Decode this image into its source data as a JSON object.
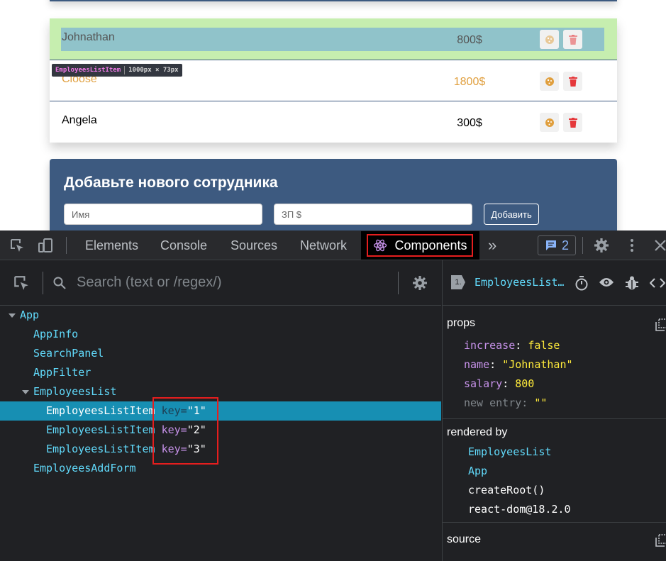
{
  "page": {
    "employees": [
      {
        "name": "Johnathan",
        "salary": "800$"
      },
      {
        "name": "Cloose",
        "salary": "1800$"
      },
      {
        "name": "Angela",
        "salary": "300$"
      }
    ],
    "tooltip": {
      "component": "EmployeesListItem",
      "dims": "1000px × 73px"
    },
    "add_form": {
      "title": "Добавьте нового сотрудника",
      "name_placeholder": "Имя",
      "salary_placeholder": "ЗП $",
      "submit_label": "Добавить"
    }
  },
  "devtools": {
    "tabs": [
      "Elements",
      "Console",
      "Sources",
      "Network"
    ],
    "active_tab": "Components",
    "more": "»",
    "issues_count": "2",
    "search_placeholder": "Search (text or /regex/)",
    "tree": [
      {
        "name": "App"
      },
      {
        "name": "AppInfo"
      },
      {
        "name": "SearchPanel"
      },
      {
        "name": "AppFilter"
      },
      {
        "name": "EmployeesList"
      },
      {
        "name": "EmployeesListItem",
        "key_attr": "key",
        "key_eq": "=",
        "key": "\"1\""
      },
      {
        "name": "EmployeesListItem",
        "key_attr": "key",
        "key_eq": "=",
        "key": "\"2\""
      },
      {
        "name": "EmployeesListItem",
        "key_attr": "key",
        "key_eq": "=",
        "key": "\"3\""
      },
      {
        "name": "EmployeesAddForm"
      }
    ],
    "inspector": {
      "badge": "1.",
      "component": "EmployeesList…",
      "props_heading": "props",
      "props": [
        {
          "key": "increase",
          "sep": ":",
          "value": "false"
        },
        {
          "key": "name",
          "sep": ":",
          "value": "\"Johnathan\""
        },
        {
          "key": "salary",
          "sep": ":",
          "value": "800"
        },
        {
          "key": "new entry",
          "sep": ":",
          "value": "\"\""
        }
      ],
      "rendered_by_heading": "rendered by",
      "rendered_by": [
        "EmployeesList",
        "App",
        "createRoot()",
        "react-dom@18.2.0"
      ],
      "source_heading": "source"
    }
  },
  "colors": {
    "accent_blue": "#3d5a80",
    "react_cyan": "#61dafb",
    "selection": "#178fb3",
    "highlight_red": "#e51e1e",
    "salary_orange": "#e09f3e"
  }
}
